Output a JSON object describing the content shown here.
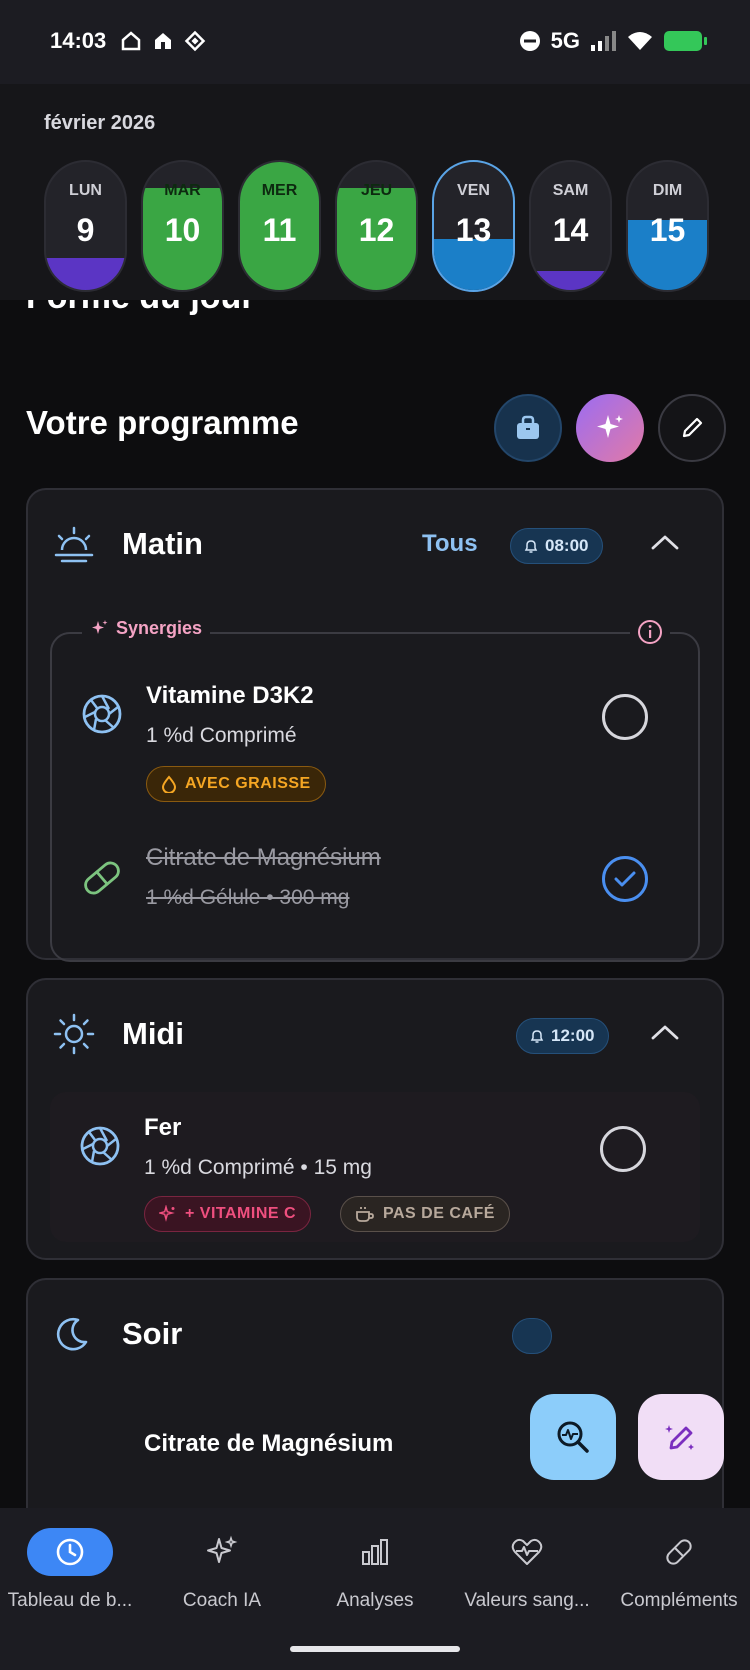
{
  "status_bar": {
    "time": "14:03",
    "network": "5G"
  },
  "header": {
    "month": "février 2026",
    "days": [
      {
        "label": "LUN",
        "number": "9",
        "fill_color": "#5b35c4",
        "fill_fraction": 0.25
      },
      {
        "label": "MAR",
        "number": "10",
        "fill_color": "#3aa644",
        "fill_fraction": 0.8
      },
      {
        "label": "MER",
        "number": "11",
        "fill_color": "#3aa644",
        "fill_fraction": 1.0
      },
      {
        "label": "JEU",
        "number": "12",
        "fill_color": "#3aa644",
        "fill_fraction": 0.8
      },
      {
        "label": "VEN",
        "number": "13",
        "fill_color": "#1b7fc8",
        "fill_fraction": 0.4
      },
      {
        "label": "SAM",
        "number": "14",
        "fill_color": "#5b35c4",
        "fill_fraction": 0.15
      },
      {
        "label": "DIM",
        "number": "15",
        "fill_color": "#1b7fc8",
        "fill_fraction": 0.55
      }
    ]
  },
  "main": {
    "cut_title": "Forme du jour",
    "section_title": "Votre programme",
    "matin": {
      "title": "Matin",
      "all_label": "Tous",
      "time": "08:00",
      "synergy_label": "Synergies",
      "items": [
        {
          "name": "Vitamine D3K2",
          "detail": "1 %d Comprimé",
          "tag": "AVEC GRAISSE",
          "checked": false
        },
        {
          "name": "Citrate de Magnésium",
          "detail": "1 %d Gélule  •  300 mg",
          "checked": true
        }
      ]
    },
    "midi": {
      "title": "Midi",
      "time": "12:00",
      "items": [
        {
          "name": "Fer",
          "detail": "1 %d Comprimé  •  15 mg",
          "tags": [
            "+ VITAMINE C",
            "PAS DE CAFÉ"
          ],
          "checked": false
        }
      ]
    },
    "soir": {
      "title": "Soir",
      "partial_item": "Citrate de Magnésium"
    }
  },
  "bottom_nav": {
    "items": [
      {
        "label": "Tableau de b...",
        "icon": "clock-icon",
        "active": true
      },
      {
        "label": "Coach IA",
        "icon": "sparkle-icon",
        "active": false
      },
      {
        "label": "Analyses",
        "icon": "bar-chart-icon",
        "active": false
      },
      {
        "label": "Valeurs sang...",
        "icon": "heart-pulse-icon",
        "active": false
      },
      {
        "label": "Compléments",
        "icon": "pill-icon",
        "active": false
      }
    ]
  }
}
